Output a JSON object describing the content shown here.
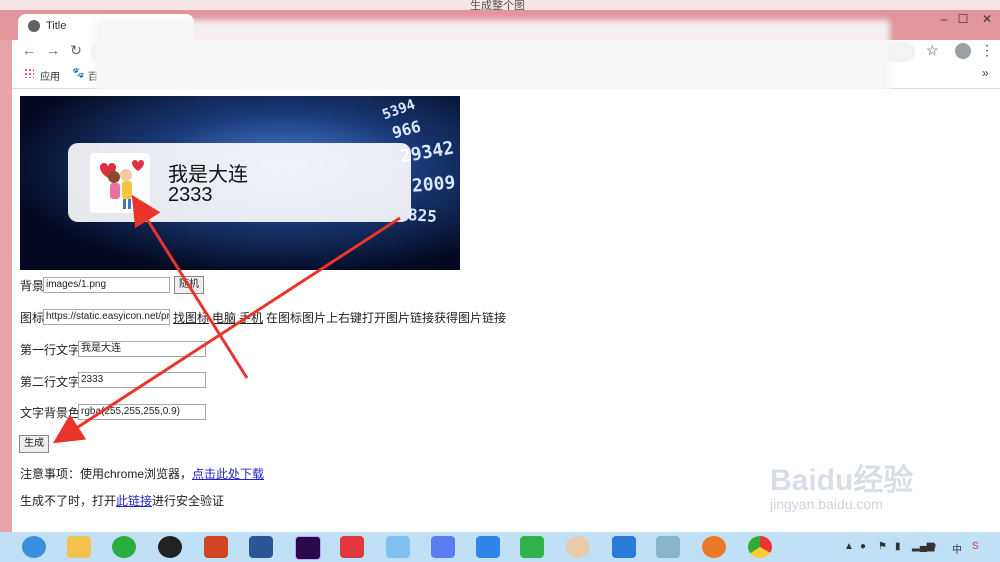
{
  "window": {
    "title": "生成整个图",
    "min": "–",
    "max": "☐",
    "close": "✕"
  },
  "tab": {
    "title": "Title"
  },
  "nav": {
    "back": "←",
    "forward": "→",
    "reload": "↻",
    "star": "☆",
    "more": "⋮"
  },
  "bookmarks": {
    "apps": "应用",
    "item1": "百",
    "overflow": "»"
  },
  "card": {
    "line1": "我是大连",
    "line2": "2333"
  },
  "form": {
    "bg_label": "背景",
    "bg_value": "images/1.png",
    "random_button": "随机",
    "icon_label": "图标",
    "icon_value": "https://static.easyicon.net/pre",
    "find_icon": "找图标",
    "computer": "电脑",
    "phone": "手机",
    "icon_hint": "在图标图片上右键打开图片链接获得图片链接",
    "line1_label": "第一行文字",
    "line1_value": "我是大连",
    "line2_label": "第二行文字",
    "line2_value": "2333",
    "bgcolor_label": "文字背景色",
    "bgcolor_value": "rgba(255,255,255,0.9)",
    "generate_button": "生成"
  },
  "notes": {
    "note_prefix": "注意事项：使用chrome浏览器，",
    "download_link": "点击此处下载",
    "fail_prefix": "生成不了时，打开",
    "fail_link": "此链接",
    "fail_suffix": "进行安全验证"
  },
  "banner_numbers": [
    "5394",
    "966",
    "29342",
    "2009",
    "825"
  ],
  "watermark": {
    "brand": "Baidu经验",
    "url": "jingyan.baidu.com"
  },
  "colors": {
    "arrow": "#e8352a",
    "titlebar": "#e3959e",
    "taskbar": "#bfe0f5",
    "link": "#2222cc"
  },
  "taskbar": {
    "icons": [
      "browser-360-icon",
      "file-explorer-icon",
      "wechat-icon",
      "qq-icon",
      "powerpoint-icon",
      "word-icon",
      "premiere-icon",
      "app-red-icon",
      "bird-app-icon",
      "feishu-icon",
      "cloud-icon",
      "phone-helper-icon",
      "photo-app-icon",
      "wps-icon",
      "book-icon",
      "fire-app-icon",
      "chrome-icon"
    ]
  }
}
